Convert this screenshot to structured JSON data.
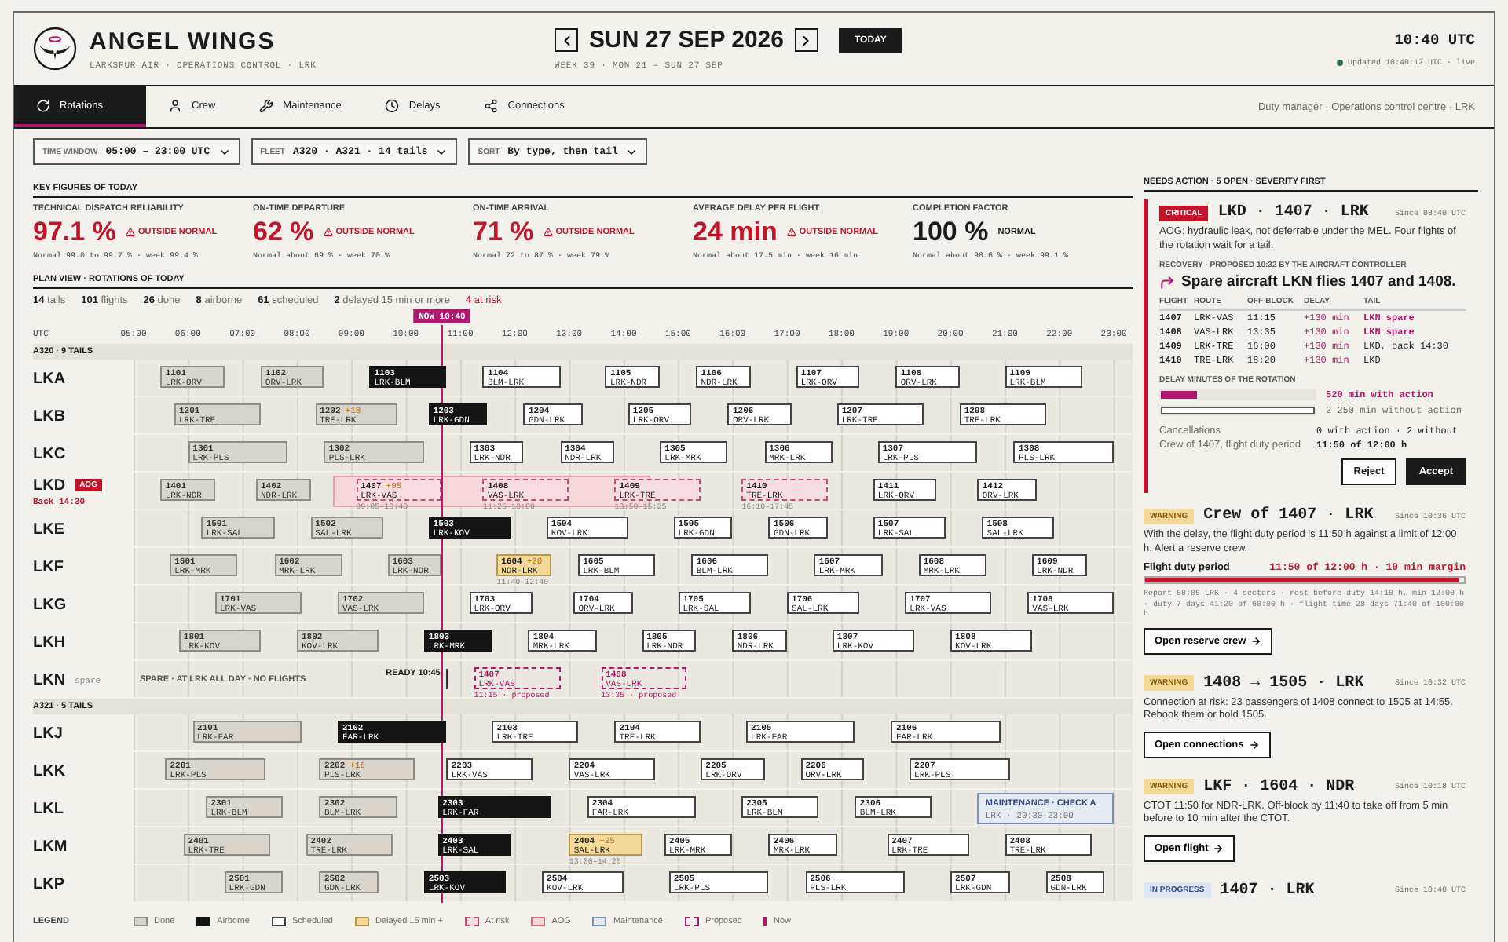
{
  "header": {
    "brand": "ANGEL WINGS",
    "subtitle": "LARKSPUR AIR · OPERATIONS CONTROL · LRK",
    "date": "SUN 27 SEP 2026",
    "today_button": "TODAY",
    "week": "WEEK 39 · MON 21 – SUN 27 SEP",
    "clock": "10:40 UTC",
    "updated": "Updated 10:40:12 UTC · live"
  },
  "tabs": [
    {
      "label": "Rotations",
      "selected": true
    },
    {
      "label": "Crew",
      "selected": false
    },
    {
      "label": "Maintenance",
      "selected": false
    },
    {
      "label": "Delays",
      "selected": false
    },
    {
      "label": "Connections",
      "selected": false
    }
  ],
  "user_context": "Duty manager · Operations control centre · LRK",
  "filters": [
    {
      "label": "TIME WINDOW",
      "value": "05:00 – 23:00 UTC"
    },
    {
      "label": "FLEET",
      "value": "A320 · A321 · 14 tails"
    },
    {
      "label": "SORT",
      "value": "By type, then tail"
    }
  ],
  "key_figures": {
    "title": "KEY FIGURES OF TODAY",
    "items": [
      {
        "label": "TECHNICAL DISPATCH RELIABILITY",
        "value": "97.1 %",
        "outside": true,
        "status_text": "OUTSIDE NORMAL",
        "note": "Normal 99.0 to 99.7 % · week 99.4 %"
      },
      {
        "label": "ON-TIME DEPARTURE",
        "value": "62 %",
        "outside": true,
        "status_text": "OUTSIDE NORMAL",
        "note": "Normal about 69 % · week 70 %"
      },
      {
        "label": "ON-TIME ARRIVAL",
        "value": "71 %",
        "outside": true,
        "status_text": "OUTSIDE NORMAL",
        "note": "Normal 72 to 87 % · week 79 %"
      },
      {
        "label": "AVERAGE DELAY PER FLIGHT",
        "value": "24 min",
        "outside": true,
        "status_text": "OUTSIDE NORMAL",
        "note": "Normal about 17.5 min · week 16 min"
      },
      {
        "label": "COMPLETION FACTOR",
        "value": "100 %",
        "outside": false,
        "status_text": "NORMAL",
        "note": "Normal about 98.6 % · week 99.1 %"
      }
    ]
  },
  "plan": {
    "title": "PLAN VIEW · ROTATIONS OF TODAY",
    "stats": [
      {
        "text": "**14** tails",
        "alert": false
      },
      {
        "text": "**101** flights",
        "alert": false
      },
      {
        "text": "**26** done",
        "alert": false
      },
      {
        "text": "**8** airborne",
        "alert": false
      },
      {
        "text": "**61** scheduled",
        "alert": false
      },
      {
        "text": "**2** delayed 15 min or more",
        "alert": false
      },
      {
        "text": "**4** at risk",
        "alert": true
      }
    ],
    "axis_label": "UTC",
    "hours": [
      "05:00",
      "06:00",
      "07:00",
      "08:00",
      "09:00",
      "10:00",
      "11:00",
      "12:00",
      "13:00",
      "14:00",
      "15:00",
      "16:00",
      "17:00",
      "18:00",
      "19:00",
      "20:00",
      "21:00",
      "22:00",
      "23:00"
    ],
    "now_label": "NOW 10:40",
    "groups": [
      {
        "title": "A320 · 9 TAILS",
        "rows": [
          {
            "tail": "LKA",
            "flights": [
              {
                "no": "1101",
                "route": "LRK-ORV",
                "kind": "done"
              },
              {
                "no": "1102",
                "route": "ORV-LRK",
                "kind": "done"
              },
              {
                "no": "1103",
                "route": "LRK-BLM",
                "kind": "airborne"
              },
              {
                "no": "1104",
                "route": "BLM-LRK",
                "kind": "scheduled"
              },
              {
                "no": "1105",
                "route": "LRK-NDR",
                "kind": "scheduled"
              },
              {
                "no": "1106",
                "route": "NDR-LRK",
                "kind": "scheduled"
              },
              {
                "no": "1107",
                "route": "LRK-ORV",
                "kind": "scheduled"
              },
              {
                "no": "1108",
                "route": "ORV-LRK",
                "kind": "scheduled"
              },
              {
                "no": "1109",
                "route": "LRK-BLM",
                "kind": "scheduled"
              }
            ]
          },
          {
            "tail": "LKB",
            "flights": [
              {
                "no": "1201",
                "route": "LRK-TRE",
                "kind": "done"
              },
              {
                "no": "1202",
                "route": "TRE-LRK",
                "kind": "done",
                "delay": "+18"
              },
              {
                "no": "1203",
                "route": "LRK-GDN",
                "kind": "airborne"
              },
              {
                "no": "1204",
                "route": "GDN-LRK",
                "kind": "scheduled"
              },
              {
                "no": "1205",
                "route": "LRK-ORV",
                "kind": "scheduled"
              },
              {
                "no": "1206",
                "route": "ORV-LRK",
                "kind": "scheduled"
              },
              {
                "no": "1207",
                "route": "LRK-TRE",
                "kind": "scheduled"
              },
              {
                "no": "1208",
                "route": "TRE-LRK",
                "kind": "scheduled"
              }
            ]
          },
          {
            "tail": "LKC",
            "flights": [
              {
                "no": "1301",
                "route": "LRK-PLS",
                "kind": "done"
              },
              {
                "no": "1302",
                "route": "PLS-LRK",
                "kind": "done"
              },
              {
                "no": "1303",
                "route": "LRK-NDR",
                "kind": "scheduled"
              },
              {
                "no": "1304",
                "route": "NDR-LRK",
                "kind": "scheduled"
              },
              {
                "no": "1305",
                "route": "LRK-MRK",
                "kind": "scheduled"
              },
              {
                "no": "1306",
                "route": "MRK-LRK",
                "kind": "scheduled"
              },
              {
                "no": "1307",
                "route": "LRK-PLS",
                "kind": "scheduled"
              },
              {
                "no": "1308",
                "route": "PLS-LRK",
                "kind": "scheduled"
              }
            ]
          },
          {
            "tail": "LKD",
            "badge": "AOG",
            "note": "Back 14:30",
            "flights": [
              {
                "no": "1401",
                "route": "LRK-NDR",
                "kind": "done"
              },
              {
                "no": "1402",
                "route": "NDR-LRK",
                "kind": "done"
              },
              {
                "no": "1407",
                "route": "LRK-VAS",
                "kind": "at_risk",
                "delay": "+95",
                "times": "09:05–10:40"
              },
              {
                "no": "1408",
                "route": "VAS-LRK",
                "kind": "at_risk",
                "times": "11:25–13:00"
              },
              {
                "no": "1409",
                "route": "LRK-TRE",
                "kind": "at_risk",
                "times": "13:50–15:25"
              },
              {
                "no": "1410",
                "route": "TRE-LRK",
                "kind": "at_risk",
                "times": "16:10–17:45"
              },
              {
                "no": "1411",
                "route": "LRK-ORV",
                "kind": "scheduled"
              },
              {
                "no": "1412",
                "route": "ORV-LRK",
                "kind": "scheduled"
              }
            ]
          },
          {
            "tail": "LKE",
            "flights": [
              {
                "no": "1501",
                "route": "LRK-SAL",
                "kind": "done"
              },
              {
                "no": "1502",
                "route": "SAL-LRK",
                "kind": "done"
              },
              {
                "no": "1503",
                "route": "LRK-KOV",
                "kind": "airborne"
              },
              {
                "no": "1504",
                "route": "KOV-LRK",
                "kind": "scheduled"
              },
              {
                "no": "1505",
                "route": "LRK-GDN",
                "kind": "scheduled"
              },
              {
                "no": "1506",
                "route": "GDN-LRK",
                "kind": "scheduled"
              },
              {
                "no": "1507",
                "route": "LRK-SAL",
                "kind": "scheduled"
              },
              {
                "no": "1508",
                "route": "SAL-LRK",
                "kind": "scheduled"
              }
            ]
          },
          {
            "tail": "LKF",
            "flights": [
              {
                "no": "1601",
                "route": "LRK-MRK",
                "kind": "done"
              },
              {
                "no": "1602",
                "route": "MRK-LRK",
                "kind": "done"
              },
              {
                "no": "1603",
                "route": "LRK-NDR",
                "kind": "done"
              },
              {
                "no": "1604",
                "route": "NDR-LRK",
                "kind": "delayed",
                "delay": "+20",
                "times": "11:40–12:40"
              },
              {
                "no": "1605",
                "route": "LRK-BLM",
                "kind": "scheduled"
              },
              {
                "no": "1606",
                "route": "BLM-LRK",
                "kind": "scheduled"
              },
              {
                "no": "1607",
                "route": "LRK-MRK",
                "kind": "scheduled"
              },
              {
                "no": "1608",
                "route": "MRK-LRK",
                "kind": "scheduled"
              },
              {
                "no": "1609",
                "route": "LRK-NDR",
                "kind": "scheduled"
              }
            ]
          },
          {
            "tail": "LKG",
            "flights": [
              {
                "no": "1701",
                "route": "LRK-VAS",
                "kind": "done"
              },
              {
                "no": "1702",
                "route": "VAS-LRK",
                "kind": "done"
              },
              {
                "no": "1703",
                "route": "LRK-ORV",
                "kind": "scheduled"
              },
              {
                "no": "1704",
                "route": "ORV-LRK",
                "kind": "scheduled"
              },
              {
                "no": "1705",
                "route": "LRK-SAL",
                "kind": "scheduled"
              },
              {
                "no": "1706",
                "route": "SAL-LRK",
                "kind": "scheduled"
              },
              {
                "no": "1707",
                "route": "LRK-VAS",
                "kind": "scheduled"
              },
              {
                "no": "1708",
                "route": "VAS-LRK",
                "kind": "scheduled"
              }
            ]
          },
          {
            "tail": "LKH",
            "flights": [
              {
                "no": "1801",
                "route": "LRK-KOV",
                "kind": "done"
              },
              {
                "no": "1802",
                "route": "KOV-LRK",
                "kind": "done"
              },
              {
                "no": "1803",
                "route": "LRK-MRK",
                "kind": "airborne"
              },
              {
                "no": "1804",
                "route": "MRK-LRK",
                "kind": "scheduled"
              },
              {
                "no": "1805",
                "route": "LRK-NDR",
                "kind": "scheduled"
              },
              {
                "no": "1806",
                "route": "NDR-LRK",
                "kind": "scheduled"
              },
              {
                "no": "1807",
                "route": "LRK-KOV",
                "kind": "scheduled"
              },
              {
                "no": "1808",
                "route": "KOV-LRK",
                "kind": "scheduled"
              }
            ]
          },
          {
            "tail": "LKN",
            "tag": "spare",
            "spare_note": "SPARE · AT LRK ALL DAY · NO FLIGHTS",
            "ready": "READY 10:45",
            "flights": [
              {
                "no": "1407",
                "route": "LRK-VAS",
                "kind": "proposed",
                "times": "11:15 · proposed"
              },
              {
                "no": "1408",
                "route": "VAS-LRK",
                "kind": "proposed",
                "times": "13:35 · proposed"
              }
            ]
          }
        ]
      },
      {
        "title": "A321 · 5 TAILS",
        "rows": [
          {
            "tail": "LKJ",
            "flights": [
              {
                "no": "2101",
                "route": "LRK-FAR",
                "kind": "done"
              },
              {
                "no": "2102",
                "route": "FAR-LRK",
                "kind": "airborne"
              },
              {
                "no": "2103",
                "route": "LRK-TRE",
                "kind": "scheduled"
              },
              {
                "no": "2104",
                "route": "TRE-LRK",
                "kind": "scheduled"
              },
              {
                "no": "2105",
                "route": "LRK-FAR",
                "kind": "scheduled"
              },
              {
                "no": "2106",
                "route": "FAR-LRK",
                "kind": "scheduled"
              }
            ]
          },
          {
            "tail": "LKK",
            "flights": [
              {
                "no": "2201",
                "route": "LRK-PLS",
                "kind": "done"
              },
              {
                "no": "2202",
                "route": "PLS-LRK",
                "kind": "done",
                "delay": "+16"
              },
              {
                "no": "2203",
                "route": "LRK-VAS",
                "kind": "scheduled"
              },
              {
                "no": "2204",
                "route": "VAS-LRK",
                "kind": "scheduled"
              },
              {
                "no": "2205",
                "route": "LRK-ORV",
                "kind": "scheduled"
              },
              {
                "no": "2206",
                "route": "ORV-LRK",
                "kind": "scheduled"
              },
              {
                "no": "2207",
                "route": "LRK-PLS",
                "kind": "scheduled"
              }
            ]
          },
          {
            "tail": "LKL",
            "flights": [
              {
                "no": "2301",
                "route": "LRK-BLM",
                "kind": "done"
              },
              {
                "no": "2302",
                "route": "BLM-LRK",
                "kind": "done"
              },
              {
                "no": "2303",
                "route": "LRK-FAR",
                "kind": "airborne"
              },
              {
                "no": "2304",
                "route": "FAR-LRK",
                "kind": "scheduled"
              },
              {
                "no": "2305",
                "route": "LRK-BLM",
                "kind": "scheduled"
              },
              {
                "no": "2306",
                "route": "BLM-LRK",
                "kind": "scheduled"
              },
              {
                "no": "MAINTENANCE · CHECK A",
                "route": "LRK · 20:30–23:00",
                "kind": "maintenance"
              }
            ]
          },
          {
            "tail": "LKM",
            "flights": [
              {
                "no": "2401",
                "route": "LRK-TRE",
                "kind": "done"
              },
              {
                "no": "2402",
                "route": "TRE-LRK",
                "kind": "done"
              },
              {
                "no": "2403",
                "route": "LRK-SAL",
                "kind": "airborne"
              },
              {
                "no": "2404",
                "route": "SAL-LRK",
                "kind": "delayed",
                "delay": "+25",
                "times": "13:00–14:20"
              },
              {
                "no": "2405",
                "route": "LRK-MRK",
                "kind": "scheduled"
              },
              {
                "no": "2406",
                "route": "MRK-LRK",
                "kind": "scheduled"
              },
              {
                "no": "2407",
                "route": "LRK-TRE",
                "kind": "scheduled"
              },
              {
                "no": "2408",
                "route": "TRE-LRK",
                "kind": "scheduled"
              }
            ]
          },
          {
            "tail": "LKP",
            "flights": [
              {
                "no": "2501",
                "route": "LRK-GDN",
                "kind": "done"
              },
              {
                "no": "2502",
                "route": "GDN-LRK",
                "kind": "done"
              },
              {
                "no": "2503",
                "route": "LRK-KOV",
                "kind": "airborne"
              },
              {
                "no": "2504",
                "route": "KOV-LRK",
                "kind": "scheduled"
              },
              {
                "no": "2505",
                "route": "LRK-PLS",
                "kind": "scheduled"
              },
              {
                "no": "2506",
                "route": "PLS-LRK",
                "kind": "scheduled"
              },
              {
                "no": "2507",
                "route": "LRK-GDN",
                "kind": "scheduled"
              },
              {
                "no": "2508",
                "route": "GDN-LRK",
                "kind": "scheduled"
              }
            ]
          }
        ]
      }
    ],
    "legend_title": "LEGEND",
    "legend": [
      {
        "kind": "done",
        "label": "Done"
      },
      {
        "kind": "airborne",
        "label": "Airborne"
      },
      {
        "kind": "scheduled",
        "label": "Scheduled"
      },
      {
        "kind": "delayed",
        "label": "Delayed 15 min +"
      },
      {
        "kind": "at_risk",
        "label": "At risk"
      },
      {
        "kind": "aog",
        "label": "AOG"
      },
      {
        "kind": "maintenance",
        "label": "Maintenance"
      },
      {
        "kind": "proposed",
        "label": "Proposed"
      },
      {
        "kind": "now",
        "label": "Now"
      }
    ]
  },
  "needs_action": {
    "title": "NEEDS ACTION · 5 OPEN · SEVERITY FIRST",
    "alerts": [
      {
        "kind": "critical",
        "badge": "CRITICAL",
        "title": "LKD · 1407 · LRK",
        "since": "Since 08:40 UTC",
        "text": "AOG: hydraulic leak, not deferrable under the MEL. Four flights of the rotation wait for a tail.",
        "recovery": {
          "label": "RECOVERY · PROPOSED 10:32 BY THE AIRCRAFT CONTROLLER",
          "proposal": "Spare aircraft LKN flies 1407 and 1408.",
          "columns": [
            "FLIGHT",
            "ROUTE",
            "OFF-BLOCK",
            "DELAY",
            "TAIL"
          ],
          "rows": [
            {
              "flight": "1407",
              "route": "LRK-VAS",
              "off_block": "11:15",
              "delay": "+130 min",
              "tail": "LKN spare",
              "highlight": true
            },
            {
              "flight": "1408",
              "route": "VAS-LRK",
              "off_block": "13:35",
              "delay": "+130 min",
              "tail": "LKN spare",
              "highlight": true
            },
            {
              "flight": "1409",
              "route": "LRK-TRE",
              "off_block": "16:00",
              "delay": "+130 min",
              "tail": "LKD, back 14:30",
              "highlight": false
            },
            {
              "flight": "1410",
              "route": "TRE-LRK",
              "off_block": "18:20",
              "delay": "+130 min",
              "tail": "LKD",
              "highlight": false
            }
          ],
          "delay_title": "DELAY MINUTES OF THE ROTATION",
          "delay_bars": [
            {
              "kind": "with_action",
              "level": 0.23,
              "label": "520 min with action"
            },
            {
              "kind": "without_action",
              "level": 1,
              "label": "2 250 min without action"
            }
          ],
          "facts": [
            {
              "label": "Cancellations",
              "value": "0 with action · 2 without",
              "emphasis": false
            },
            {
              "label": "Crew of 1407, flight duty period",
              "value": "11:50 of 12:00 h",
              "emphasis": true
            }
          ],
          "buttons": [
            {
              "label": "Reject",
              "kind": "secondary"
            },
            {
              "label": "Accept",
              "kind": "primary"
            }
          ]
        }
      },
      {
        "kind": "warning",
        "badge": "WARNING",
        "title": "Crew of 1407 · LRK",
        "since": "Since 10:36 UTC",
        "text": "With the delay, the flight duty period is 11:50 h against a limit of 12:00 h. Alert a reserve crew.",
        "meter": {
          "label": "Flight duty period",
          "reading": "11:50 of 12:00 h · 10 min margin",
          "level": 0.986,
          "detail": "Report 08:05 LRK · 4 sectors · rest before duty 14:10 h, min 12:00 h · duty 7 days 41:20 of 60:00 h · flight time 28 days 71:40 of 100:00 h"
        },
        "action": "Open reserve crew"
      },
      {
        "kind": "warning",
        "badge": "WARNING",
        "title": "1408 → 1505 · LRK",
        "since": "Since 10:32 UTC",
        "text": "Connection at risk: 23 passengers of 1408 connect to 1505 at 14:55. Rebook them or hold 1505.",
        "action": "Open connections"
      },
      {
        "kind": "warning",
        "badge": "WARNING",
        "title": "LKF · 1604 · NDR",
        "since": "Since 10:18 UTC",
        "text": "CTOT 11:50 for NDR-LRK. Off-block by 11:40 to take off from 5 min before to 10 min after the CTOT.",
        "action": "Open flight"
      },
      {
        "kind": "in_progress",
        "badge": "IN PROGRESS",
        "title": "1407 · LRK",
        "since": "Since 10:40 UTC"
      }
    ]
  }
}
